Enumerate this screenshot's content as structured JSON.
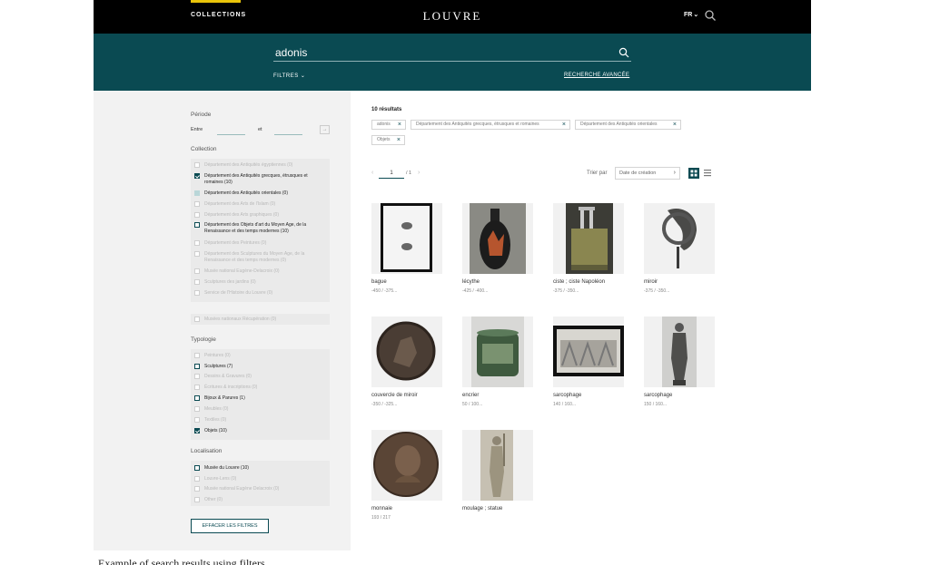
{
  "header": {
    "collections_label": "COLLECTIONS",
    "logo": "LOUVRE",
    "lang": "FR"
  },
  "search": {
    "query": "adonis",
    "filters_label": "FILTRES",
    "advanced_label": "RECHERCHE AVANCÉE"
  },
  "sidebar": {
    "period_title": "Période",
    "between_label": "Entre",
    "and_label": "et",
    "collection_title": "Collection",
    "collection_items": [
      {
        "label": "Département des Antiquités égyptiennes (0)",
        "state": "dim"
      },
      {
        "label": "Département des Antiquités grecques, étrusques et romaines (10)",
        "state": "checked"
      },
      {
        "label": "Département des Antiquités orientales (0)",
        "state": "partial"
      },
      {
        "label": "Département des Arts de l'Islam (0)",
        "state": "dim"
      },
      {
        "label": "Département des Arts graphiques (0)",
        "state": "dim"
      },
      {
        "label": "Département des Objets d'art du Moyen Age, de la Renaissance et des temps modernes (10)",
        "state": "unchecked"
      },
      {
        "label": "Département des Peintures (0)",
        "state": "dim"
      },
      {
        "label": "Département des Sculptures du Moyen Age, de la Renaissance et des temps modernes (0)",
        "state": "dim"
      },
      {
        "label": "Musée national Eugène-Delacroix (0)",
        "state": "dim"
      },
      {
        "label": "Sculptures des jardins (0)",
        "state": "dim"
      },
      {
        "label": "Service de l'Histoire du Louvre (0)",
        "state": "dim"
      }
    ],
    "collection_extra": {
      "label": "Musées nationaux Récupération (0)",
      "state": "dim"
    },
    "typology_title": "Typologie",
    "typology_items": [
      {
        "label": "Peintures (0)",
        "state": "dim"
      },
      {
        "label": "Sculptures (7)",
        "state": "unchecked"
      },
      {
        "label": "Dessins & Gravures (0)",
        "state": "dim"
      },
      {
        "label": "Écritures & inscriptions (0)",
        "state": "dim"
      },
      {
        "label": "Bijoux & Parures (1)",
        "state": "unchecked"
      },
      {
        "label": "Meubles (0)",
        "state": "dim"
      },
      {
        "label": "Textiles (0)",
        "state": "dim"
      },
      {
        "label": "Objets (10)",
        "state": "checked"
      }
    ],
    "location_title": "Localisation",
    "location_items": [
      {
        "label": "Musée du Louvre (10)",
        "state": "unchecked"
      },
      {
        "label": "Louvre-Lens (0)",
        "state": "dim"
      },
      {
        "label": "Musée national Eugène Delacroix (0)",
        "state": "dim"
      },
      {
        "label": "Other (0)",
        "state": "dim"
      }
    ],
    "clear_label": "EFFACER LES FILTRES"
  },
  "results": {
    "count_label": "10 résultats",
    "chips": [
      "adonis",
      "Département des Antiquités grecques, étrusques et romaines",
      "Département des Antiquités orientales",
      "Objets"
    ],
    "page_value": "1",
    "page_of": "/ 1",
    "sort_label": "Trier par",
    "sort_value": "Date de création",
    "items": [
      {
        "name": "bague",
        "date": "-450 / -375..."
      },
      {
        "name": "lécythe",
        "date": "-425 / -400..."
      },
      {
        "name": "ciste ; ciste Napoléon",
        "date": "-375 / -350..."
      },
      {
        "name": "miroir",
        "date": "-375 / -350..."
      },
      {
        "name": "couvercle de miroir",
        "date": "-350 / -325..."
      },
      {
        "name": "encrier",
        "date": "50 / 100..."
      },
      {
        "name": "sarcophage",
        "date": "140 / 160..."
      },
      {
        "name": "sarcophage",
        "date": "150 / 160..."
      },
      {
        "name": "monnaie",
        "date": "193 / 217"
      },
      {
        "name": "moulage ; statue",
        "date": ""
      }
    ]
  },
  "caption": "Example of search results using filters"
}
